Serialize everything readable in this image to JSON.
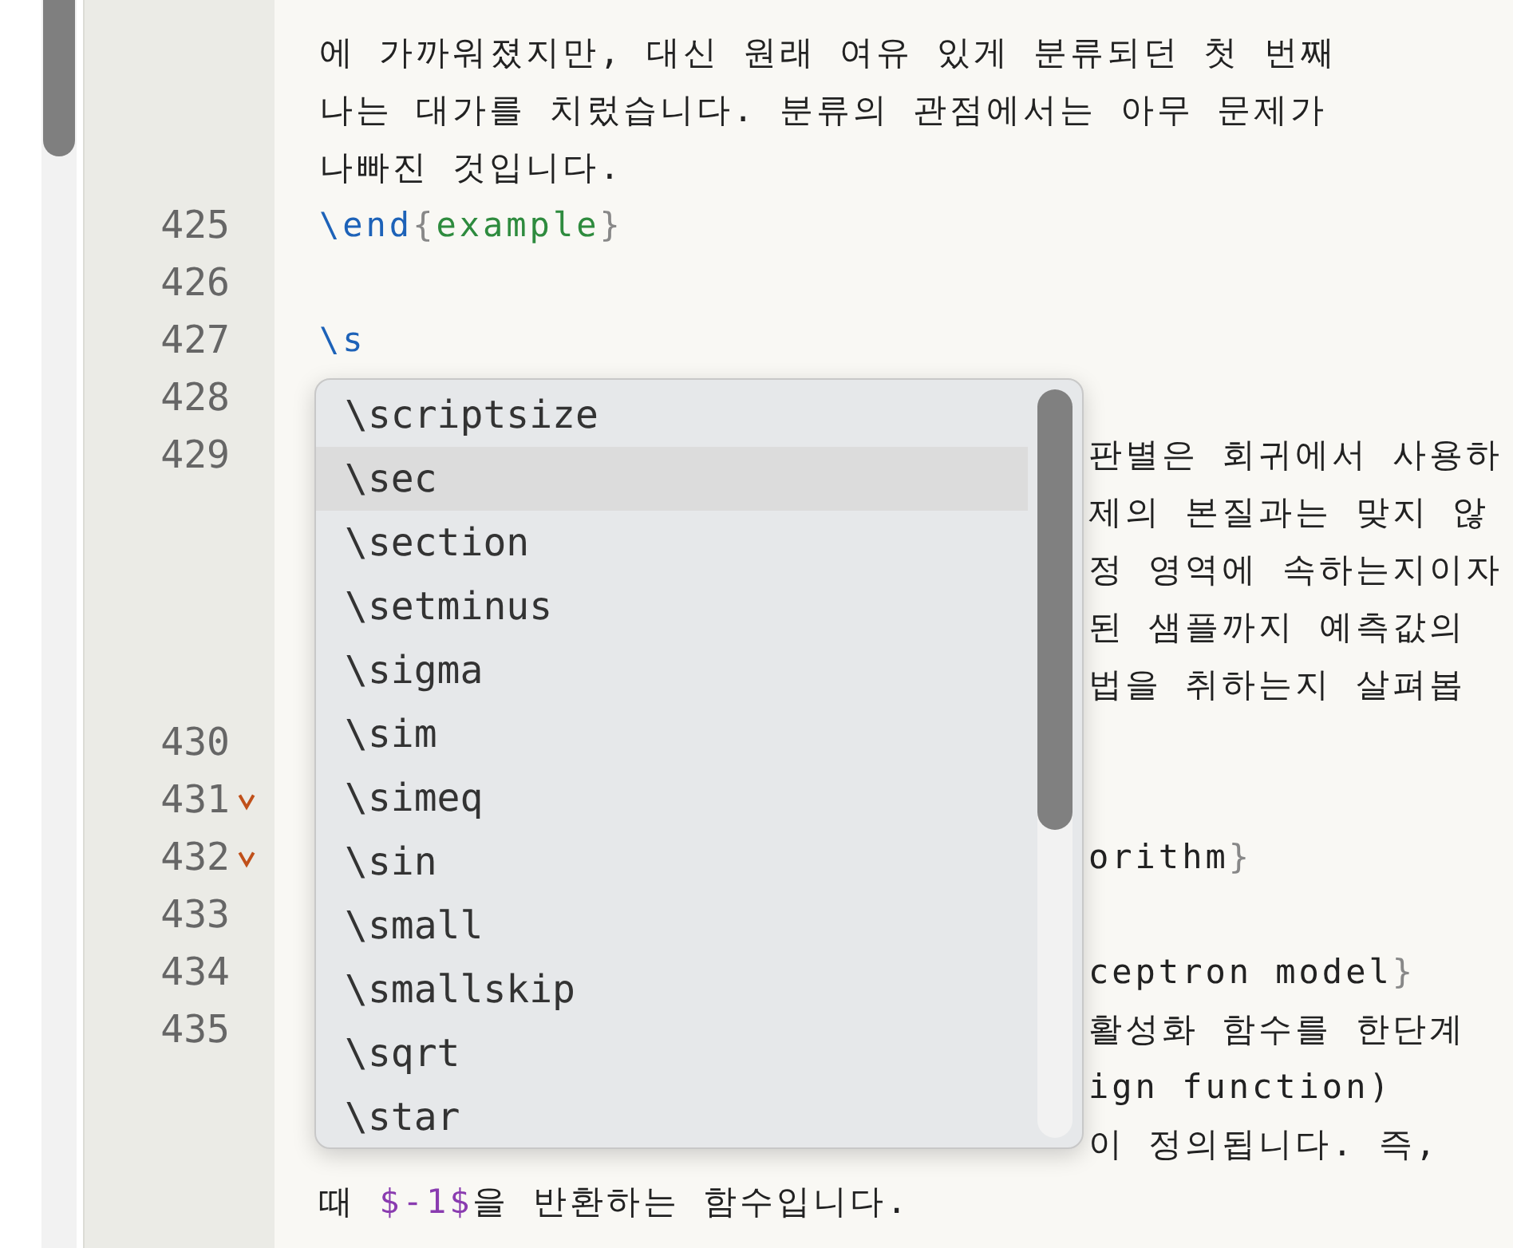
{
  "editor": {
    "rows": [
      {
        "kind": "line",
        "segments": [
          {
            "kind": "text",
            "text": "에 가까워졌지만, 대신 원래 여유 있게 분류되던 첫 번째"
          }
        ]
      },
      {
        "kind": "line",
        "segments": [
          {
            "kind": "text",
            "text": "나는 대가를 치렀습니다. 분류의 관점에서는 아무 문제가"
          }
        ]
      },
      {
        "kind": "line",
        "segments": [
          {
            "kind": "text",
            "text": "나빠진 것입니다."
          }
        ]
      },
      {
        "number": "425",
        "kind": "line",
        "segments": [
          {
            "kind": "command",
            "text": "\\end"
          },
          {
            "kind": "brace",
            "text": "{"
          },
          {
            "kind": "argument",
            "text": "example"
          },
          {
            "kind": "brace",
            "text": "}"
          }
        ]
      },
      {
        "number": "426",
        "kind": "line",
        "segments": []
      },
      {
        "number": "427",
        "kind": "line",
        "segments": [
          {
            "kind": "command",
            "text": "\\s"
          }
        ]
      },
      {
        "number": "428",
        "kind": "line",
        "segments": []
      },
      {
        "number": "429",
        "kind": "tail",
        "segments": [
          {
            "kind": "text",
            "text": "판별은 회귀에서 사용하"
          }
        ]
      },
      {
        "kind": "tail",
        "segments": [
          {
            "kind": "text",
            "text": "제의 본질과는 맞지 않"
          }
        ]
      },
      {
        "kind": "tail",
        "segments": [
          {
            "kind": "text",
            "text": "정 영역에 속하는지이자"
          }
        ]
      },
      {
        "kind": "tail",
        "segments": [
          {
            "kind": "text",
            "text": "된 샘플까지 예측값의"
          }
        ]
      },
      {
        "kind": "tail",
        "segments": [
          {
            "kind": "text",
            "text": "법을 취하는지 살펴봅"
          }
        ]
      },
      {
        "number": "430",
        "kind": "tail",
        "segments": []
      },
      {
        "number": "431",
        "fold": true,
        "kind": "tail",
        "segments": []
      },
      {
        "number": "432",
        "fold": true,
        "kind": "tail",
        "segments": [
          {
            "kind": "text",
            "text": "orithm"
          },
          {
            "kind": "brace",
            "text": "}"
          }
        ]
      },
      {
        "number": "433",
        "kind": "tail",
        "segments": []
      },
      {
        "number": "434",
        "kind": "tail",
        "segments": [
          {
            "kind": "text",
            "text": "ceptron model"
          },
          {
            "kind": "brace",
            "text": "}"
          }
        ]
      },
      {
        "number": "435",
        "kind": "tail",
        "segments": [
          {
            "kind": "text",
            "text": "활성화 함수를 한단계"
          }
        ]
      },
      {
        "kind": "tail",
        "segments": [
          {
            "kind": "text",
            "text": "ign function)"
          }
        ]
      },
      {
        "kind": "tail",
        "segments": [
          {
            "kind": "text",
            "text": "이 정의됩니다. 즉,"
          }
        ]
      },
      {
        "kind": "line",
        "segments": [
          {
            "kind": "text",
            "text": "때 "
          },
          {
            "kind": "math",
            "text": "$-1$"
          },
          {
            "kind": "text",
            "text": "을 반환하는 함수입니다."
          }
        ]
      }
    ]
  },
  "autocomplete": {
    "items": [
      {
        "label": "\\scriptsize",
        "selected": false
      },
      {
        "label": "\\sec",
        "selected": true
      },
      {
        "label": "\\section",
        "selected": false
      },
      {
        "label": "\\setminus",
        "selected": false
      },
      {
        "label": "\\sigma",
        "selected": false
      },
      {
        "label": "\\sim",
        "selected": false
      },
      {
        "label": "\\simeq",
        "selected": false
      },
      {
        "label": "\\sin",
        "selected": false
      },
      {
        "label": "\\small",
        "selected": false
      },
      {
        "label": "\\smallskip",
        "selected": false
      },
      {
        "label": "\\sqrt",
        "selected": false
      },
      {
        "label": "\\star",
        "selected": false
      }
    ]
  }
}
